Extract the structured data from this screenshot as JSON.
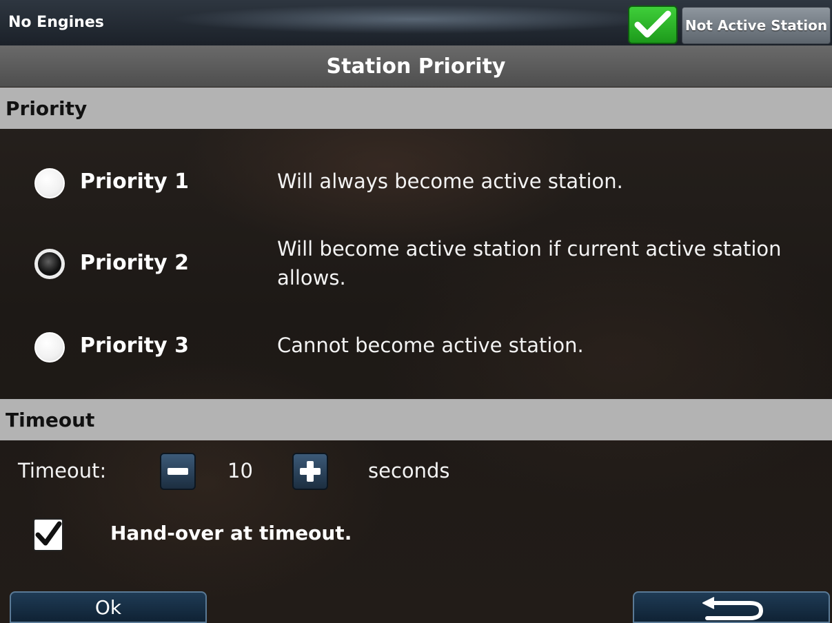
{
  "topbar": {
    "engines_label": "No Engines",
    "status_icon": "check-icon",
    "status_color": "#2fb52c",
    "station_button": "Not Active Station"
  },
  "title": "Station Priority",
  "priority_section": {
    "header": "Priority",
    "selected": "Priority 2",
    "options": [
      {
        "label": "Priority 1",
        "description": "Will always become active station.",
        "checked": false
      },
      {
        "label": "Priority 2",
        "description": "Will become active station if current active station allows.",
        "checked": true
      },
      {
        "label": "Priority 3",
        "description": "Cannot become active station.",
        "checked": false
      }
    ]
  },
  "timeout_section": {
    "header": "Timeout",
    "label": "Timeout:",
    "value": "10",
    "unit": "seconds",
    "decrement_icon": "minus-icon",
    "increment_icon": "plus-icon",
    "handover_label": "Hand-over at timeout.",
    "handover_checked": true
  },
  "footer": {
    "ok_label": "Ok",
    "back_icon": "return-arrow-icon"
  }
}
